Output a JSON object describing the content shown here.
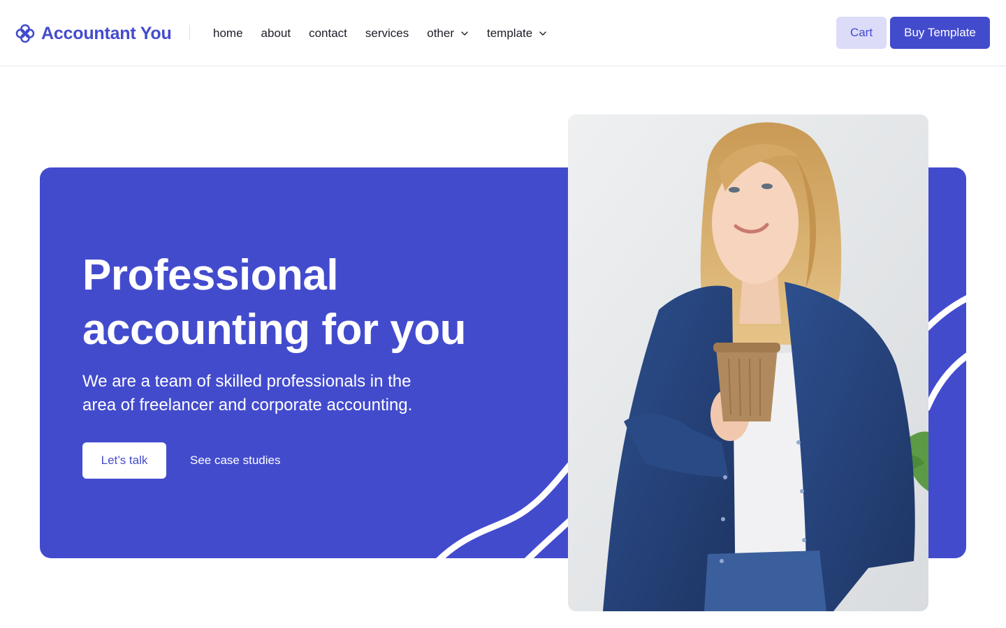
{
  "header": {
    "logo": {
      "text": "Accountant You",
      "icon": "clover-logo-icon",
      "color": "#434bcd"
    },
    "nav": [
      {
        "label": "home",
        "has_dropdown": false
      },
      {
        "label": "about",
        "has_dropdown": false
      },
      {
        "label": "contact",
        "has_dropdown": false
      },
      {
        "label": "services",
        "has_dropdown": false
      },
      {
        "label": "other",
        "has_dropdown": true
      },
      {
        "label": "template",
        "has_dropdown": true
      }
    ],
    "cart_label": "Cart",
    "buy_label": "Buy Template"
  },
  "hero": {
    "title_line1": "Professional",
    "title_line2": "accounting for you",
    "subtitle_line1": "We are a team of skilled professionals in the",
    "subtitle_line2": "area of freelancer and corporate accounting.",
    "primary_cta": "Let’s talk",
    "secondary_cta": "See case studies",
    "image": "photo-woman-holding-coffee-cup"
  },
  "colors": {
    "accent": "#434bcd",
    "accent_light": "#dcdcf8",
    "text": "#1c1c28",
    "white": "#ffffff"
  }
}
